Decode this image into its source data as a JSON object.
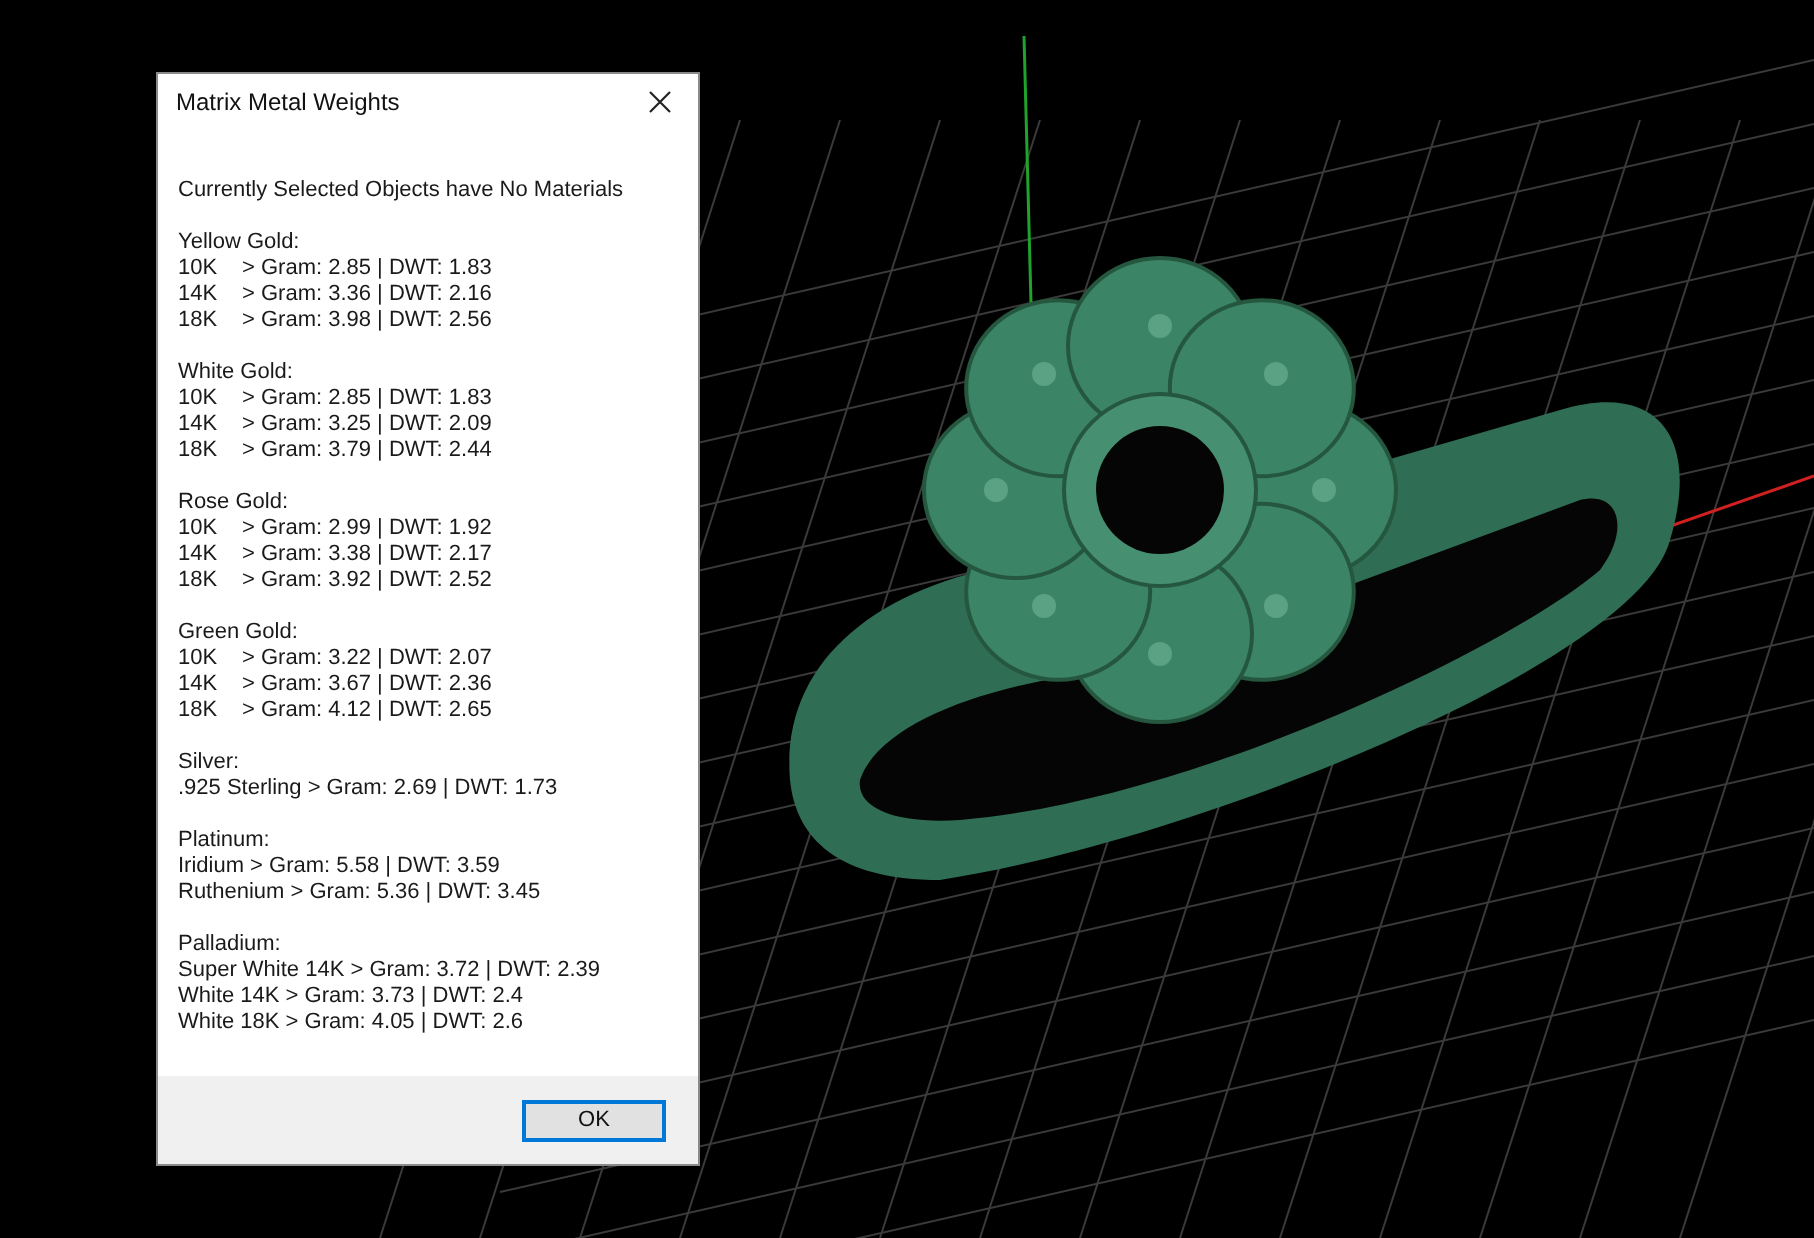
{
  "dialog": {
    "title": "Matrix Metal Weights",
    "message": "Currently Selected Objects have No Materials",
    "sections": [
      {
        "heading": "Yellow Gold:",
        "kind": "graded",
        "lines": [
          {
            "grade": "10K",
            "value": "> Gram: 2.85 | DWT: 1.83"
          },
          {
            "grade": "14K",
            "value": "> Gram: 3.36 | DWT: 2.16"
          },
          {
            "grade": "18K",
            "value": "> Gram: 3.98 | DWT: 2.56"
          }
        ]
      },
      {
        "heading": "White Gold:",
        "kind": "graded",
        "lines": [
          {
            "grade": "10K",
            "value": "> Gram: 2.85 | DWT: 1.83"
          },
          {
            "grade": "14K",
            "value": "> Gram: 3.25 | DWT: 2.09"
          },
          {
            "grade": "18K",
            "value": "> Gram: 3.79 | DWT: 2.44"
          }
        ]
      },
      {
        "heading": "Rose Gold:",
        "kind": "graded",
        "lines": [
          {
            "grade": "10K",
            "value": "> Gram: 2.99 | DWT: 1.92"
          },
          {
            "grade": "14K",
            "value": "> Gram: 3.38 | DWT: 2.17"
          },
          {
            "grade": "18K",
            "value": "> Gram: 3.92 | DWT: 2.52"
          }
        ]
      },
      {
        "heading": "Green Gold:",
        "kind": "graded",
        "lines": [
          {
            "grade": "10K",
            "value": "> Gram: 3.22 | DWT: 2.07"
          },
          {
            "grade": "14K",
            "value": "> Gram: 3.67 | DWT: 2.36"
          },
          {
            "grade": "18K",
            "value": "> Gram: 4.12 | DWT: 2.65"
          }
        ]
      },
      {
        "heading": "Silver:",
        "kind": "plain",
        "lines": [
          ".925 Sterling > Gram: 2.69 | DWT: 1.73"
        ]
      },
      {
        "heading": "Platinum:",
        "kind": "plain",
        "lines": [
          "Iridium > Gram: 5.58 | DWT: 3.59",
          "Ruthenium > Gram: 5.36 | DWT: 3.45"
        ]
      },
      {
        "heading": "Palladium:",
        "kind": "plain",
        "lines": [
          "Super White 14K > Gram: 3.72 | DWT: 2.39",
          "White 14K > Gram: 3.73 | DWT: 2.4",
          "White 18K > Gram: 4.05 | DWT: 2.6"
        ]
      }
    ],
    "ok_button": "OK"
  }
}
